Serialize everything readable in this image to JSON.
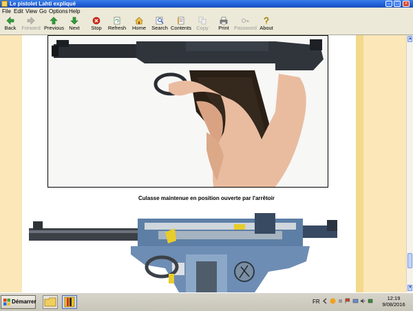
{
  "window": {
    "title": "Le pistolet Lahti expliqué"
  },
  "menu": [
    "File",
    "Edit",
    "View",
    "Go",
    "Options",
    "Help"
  ],
  "toolbar": [
    {
      "label": "Back",
      "icon": "back-arrow-icon",
      "enabled": true
    },
    {
      "label": "Forward",
      "icon": "forward-arrow-icon",
      "enabled": false
    },
    {
      "label": "Previous",
      "icon": "previous-arrow-icon",
      "enabled": true
    },
    {
      "label": "Next",
      "icon": "next-arrow-icon",
      "enabled": true
    },
    {
      "label": "Stop",
      "icon": "stop-icon",
      "enabled": true
    },
    {
      "label": "Refresh",
      "icon": "refresh-icon",
      "enabled": true
    },
    {
      "label": "Home",
      "icon": "home-icon",
      "enabled": true
    },
    {
      "label": "Search",
      "icon": "search-icon",
      "enabled": true
    },
    {
      "label": "Contents",
      "icon": "contents-icon",
      "enabled": true
    },
    {
      "label": "Copy",
      "icon": "copy-icon",
      "enabled": false
    },
    {
      "label": "Print",
      "icon": "print-icon",
      "enabled": true
    },
    {
      "label": "Password",
      "icon": "password-icon",
      "enabled": false
    },
    {
      "label": "About",
      "icon": "about-icon",
      "enabled": true
    }
  ],
  "content": {
    "photo_alt": "Pistolet Lahti, culasse ouverte",
    "caption": "Culasse maintenue en position ouverte par l'arrêtoir"
  },
  "taskbar": {
    "start_label": "Démarrer",
    "language": "FR",
    "time": "12:19",
    "date": "9/08/2016"
  },
  "colors": {
    "page_bg": "#fbe7b8",
    "stripe": "#f3d98c",
    "titlebar": "#1f5fd6"
  }
}
